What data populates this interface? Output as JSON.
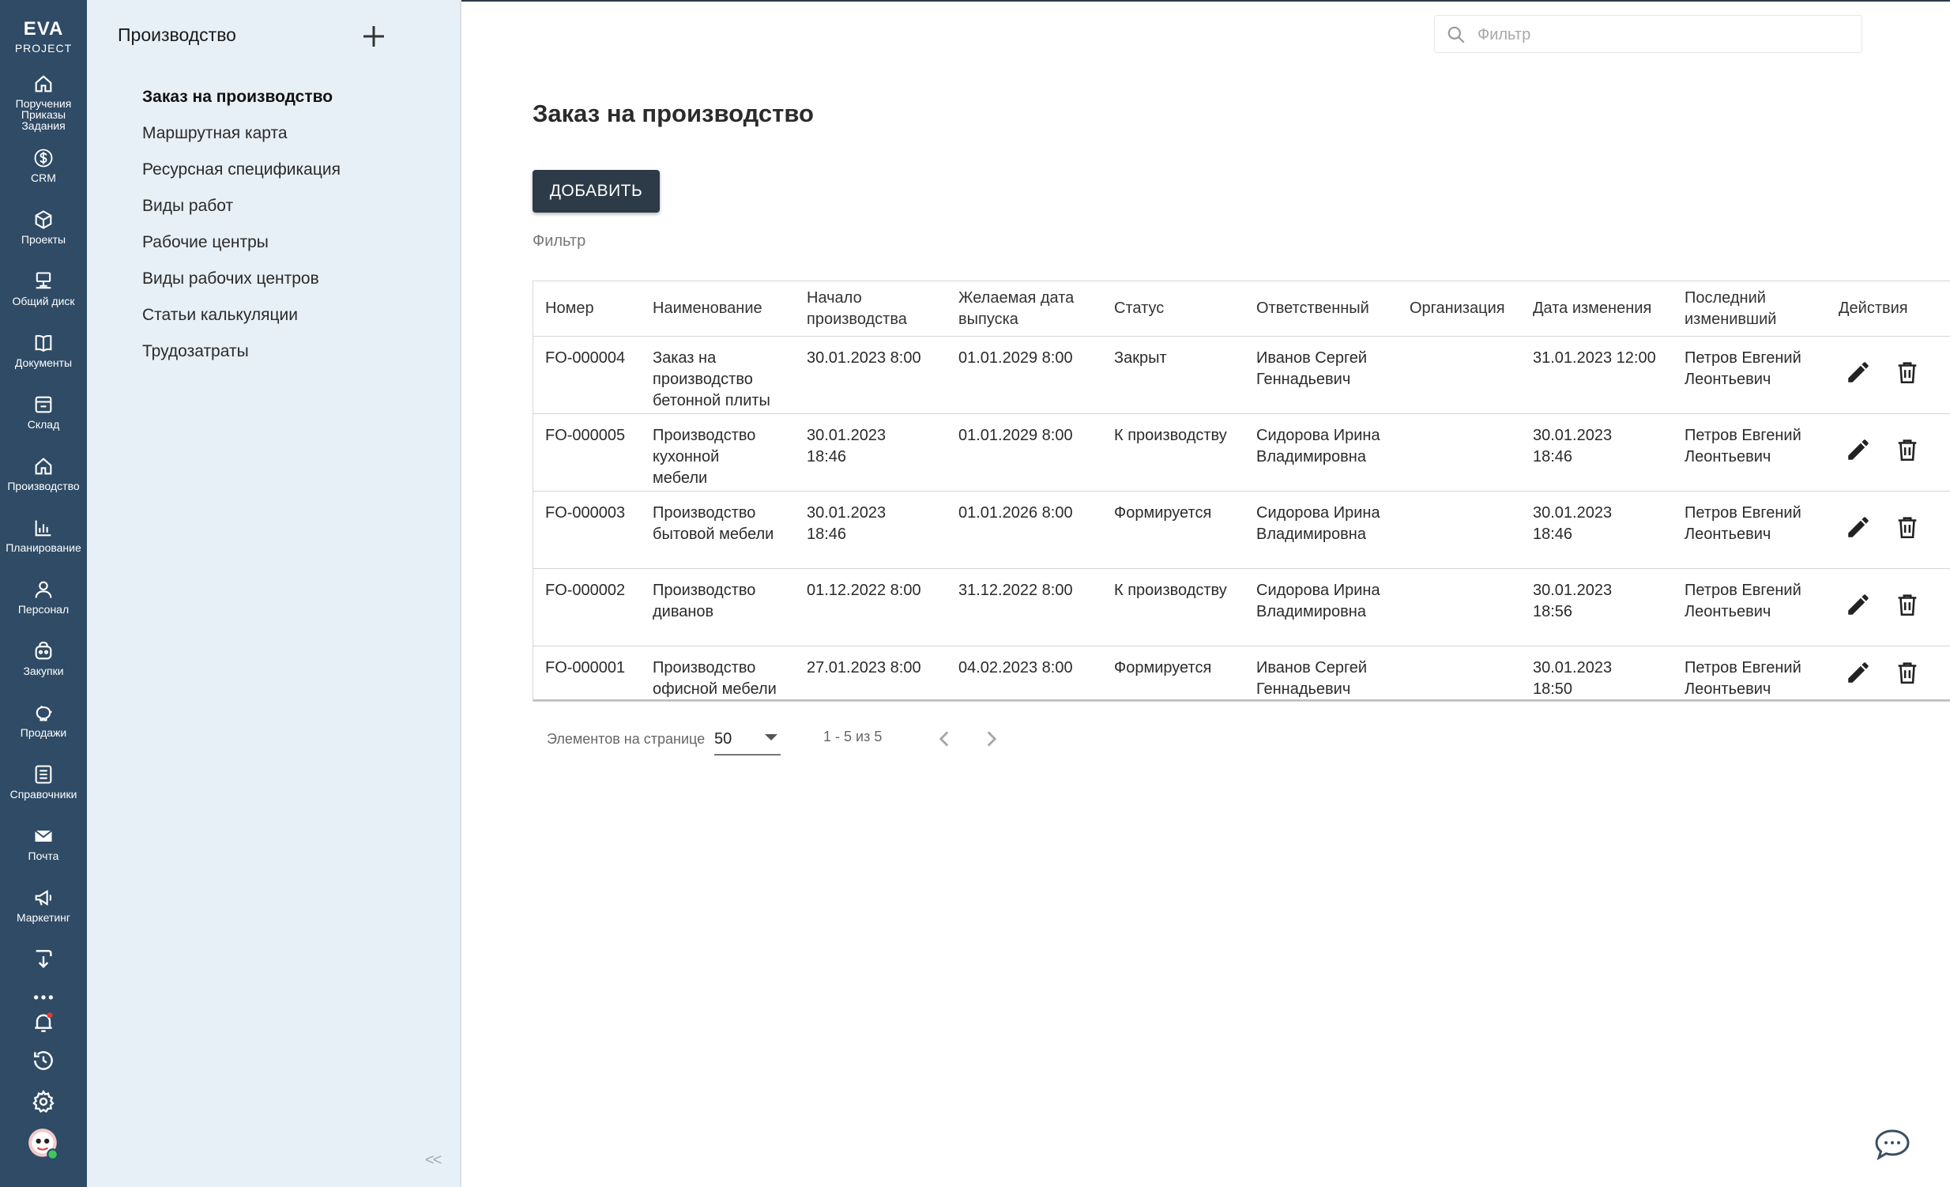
{
  "app": {
    "logo_line1": "EVA",
    "logo_line2": "PROJECT",
    "accent_color": "#2f4b65",
    "button_color": "#2d3a47"
  },
  "rail": {
    "items": [
      {
        "icon": "home-icon",
        "label": "Поручения Приказы Задания"
      },
      {
        "icon": "dollar-icon",
        "label": "CRM"
      },
      {
        "icon": "cube-icon",
        "label": "Проекты"
      },
      {
        "icon": "network-drive-icon",
        "label": "Общий диск"
      },
      {
        "icon": "book-icon",
        "label": "Документы"
      },
      {
        "icon": "warehouse-icon",
        "label": "Склад"
      },
      {
        "icon": "factory-icon",
        "label": "Производство"
      },
      {
        "icon": "chart-icon",
        "label": "Планирование"
      },
      {
        "icon": "person-icon",
        "label": "Персонал"
      },
      {
        "icon": "cart-icon",
        "label": "Закупки"
      },
      {
        "icon": "piggy-bank-icon",
        "label": "Продажи"
      },
      {
        "icon": "list-icon",
        "label": "Справочники"
      },
      {
        "icon": "mail-icon",
        "label": "Почта"
      },
      {
        "icon": "megaphone-icon",
        "label": "Маркетинг"
      }
    ],
    "utilities": [
      "tray-download-icon",
      "more-dots-icon",
      "bell-icon",
      "history-icon",
      "gear-icon",
      "avatar"
    ]
  },
  "sidebar": {
    "title": "Производство",
    "items": [
      {
        "label": "Заказ на производство",
        "active": true
      },
      {
        "label": "Маршрутная карта",
        "active": false
      },
      {
        "label": "Ресурсная спецификация",
        "active": false
      },
      {
        "label": "Виды работ",
        "active": false
      },
      {
        "label": "Рабочие центры",
        "active": false
      },
      {
        "label": "Виды рабочих центров",
        "active": false
      },
      {
        "label": "Статьи калькуляции",
        "active": false
      },
      {
        "label": "Трудозатраты",
        "active": false
      }
    ],
    "collapse_label": "<<"
  },
  "search": {
    "placeholder": "Фильтр",
    "value": ""
  },
  "main": {
    "title": "Заказ на производство",
    "add_button": "ДОБАВИТЬ",
    "filter_label": "Фильтр"
  },
  "table": {
    "columns": [
      "Номер",
      "Наименование",
      "Начало производства",
      "Желаемая дата выпуска",
      "Статус",
      "Ответственный",
      "Организация",
      "Дата изменения",
      "Последний изменивший",
      "Действия"
    ],
    "rows": [
      [
        "FO-000004",
        "Заказ на производство бетонной плиты",
        "30.01.2023 8:00",
        "01.01.2029 8:00",
        "Закрыт",
        "Иванов Сергей Геннадьевич",
        "",
        "31.01.2023 12:00",
        "Петров Евгений Леонтьевич"
      ],
      [
        "FO-000005",
        "Производство кухонной мебели",
        "30.01.2023 18:46",
        "01.01.2029 8:00",
        "К производству",
        "Сидорова Ирина Владимировна",
        "",
        "30.01.2023 18:46",
        "Петров Евгений Леонтьевич"
      ],
      [
        "FO-000003",
        "Производство бытовой мебели",
        "30.01.2023 18:46",
        "01.01.2026 8:00",
        "Формируется",
        "Сидорова Ирина Владимировна",
        "",
        "30.01.2023 18:46",
        "Петров Евгений Леонтьевич"
      ],
      [
        "FO-000002",
        "Производство диванов",
        "01.12.2022 8:00",
        "31.12.2022 8:00",
        "К производству",
        "Сидорова Ирина Владимировна",
        "",
        "30.01.2023 18:56",
        "Петров Евгений Леонтьевич"
      ],
      [
        "FO-000001",
        "Производство офисной мебели",
        "27.01.2023 8:00",
        "04.02.2023 8:00",
        "Формируется",
        "Иванов Сергей Геннадьевич",
        "",
        "30.01.2023 18:50",
        "Петров Евгений Леонтьевич"
      ]
    ]
  },
  "pagination": {
    "per_page_label": "Элементов на странице",
    "per_page_value": "50",
    "range": "1 - 5 из 5"
  }
}
